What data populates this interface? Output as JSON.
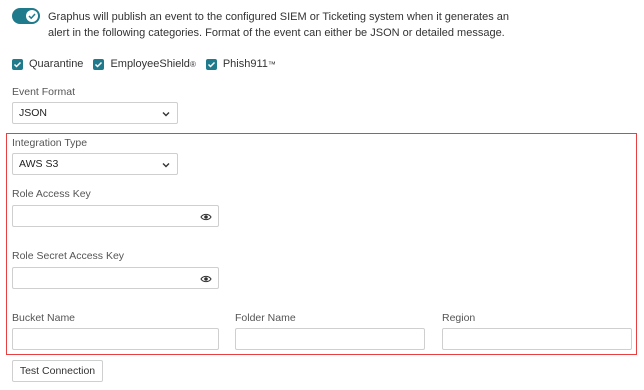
{
  "notice": {
    "text": "Graphus will publish an event to the configured SIEM or Ticketing system when it generates an alert in the following categories. Format of the event can either be JSON or detailed message.",
    "toggle_on": true
  },
  "categories": [
    {
      "label": "Quarantine",
      "mark": "",
      "checked": true
    },
    {
      "label": "EmployeeShield",
      "mark": "®",
      "checked": true
    },
    {
      "label": "Phish911",
      "mark": "™",
      "checked": true
    }
  ],
  "event_format": {
    "label": "Event Format",
    "value": "JSON"
  },
  "integration": {
    "type_label": "Integration Type",
    "type_value": "AWS S3",
    "role_access_key_label": "Role Access Key",
    "role_secret_access_key_label": "Role Secret Access Key",
    "bucket_name_label": "Bucket Name",
    "folder_name_label": "Folder Name",
    "region_label": "Region"
  },
  "actions": {
    "test_connection": "Test Connection"
  },
  "colors": {
    "accent": "#1f7a8c",
    "highlight_border": "#e84040"
  },
  "icons": {
    "toggle": "toggle-check-icon",
    "eye": "eye-icon",
    "chevron": "chevron-down-icon",
    "checkbox": "checkmark-icon"
  }
}
